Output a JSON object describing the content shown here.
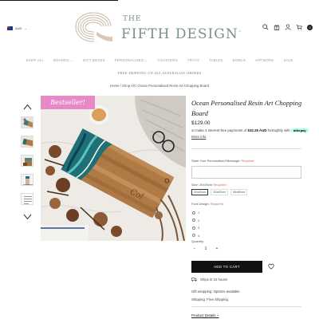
{
  "header": {
    "currency": "AUD",
    "logo_the": "THE",
    "logo_name": "FIFTH DESIGN",
    "logo_tm": "™",
    "cart_count": "0",
    "icons": [
      "search-icon",
      "gift-icon",
      "user-icon",
      "cart-icon"
    ]
  },
  "nav": {
    "items": [
      "SHOP ALL",
      "BOARDS ⌄",
      "GIFT BOXES",
      "PERSONALISED ⌄",
      "COASTERS",
      "TRAYS",
      "TABLES",
      "BOWLS",
      "ARTWORK",
      "SALE"
    ]
  },
  "shipping_banner": "FREE SHIPPING ON ALL AUSTRALIAN ORDERS",
  "breadcrumb": "Home / Shop All / Ocean Personalised Resin Art Chopping Board",
  "gallery": {
    "badge": "Bestseller!"
  },
  "product": {
    "title": "Ocean Personalised Resin Art Chopping Board",
    "price": "$129.00",
    "afterpay_prefix": "or make 4 interest-free payments of ",
    "afterpay_amount": "$32.25 AUD",
    "afterpay_suffix": " fortnightly with ",
    "afterpay_badge": "afterpay",
    "afterpay_link": "More info",
    "message_label": "State Your Personalised Message:",
    "required": "Required",
    "size_label": "Size: 20x40cm",
    "sizes": [
      "20x40cm",
      "30x60cm",
      "35x80cm"
    ],
    "font_label": "Font Design:",
    "font_options": [
      "1",
      "2",
      "3",
      "4"
    ],
    "quantity_label": "Quantity:",
    "quantity_value": "1",
    "qty_minus": "−",
    "qty_plus": "+",
    "add_to_cart": "ADD TO CART",
    "ships": "Ships in 24 hours!",
    "gift_wrapping": "Gift wrapping: Options available",
    "shipping": "Shipping: Free Shipping",
    "details_link": "Product Details +"
  },
  "colors": {
    "logo": "#7d8e8c",
    "badge": "#e889c7",
    "button": "#111111",
    "required": "#dd6655"
  }
}
